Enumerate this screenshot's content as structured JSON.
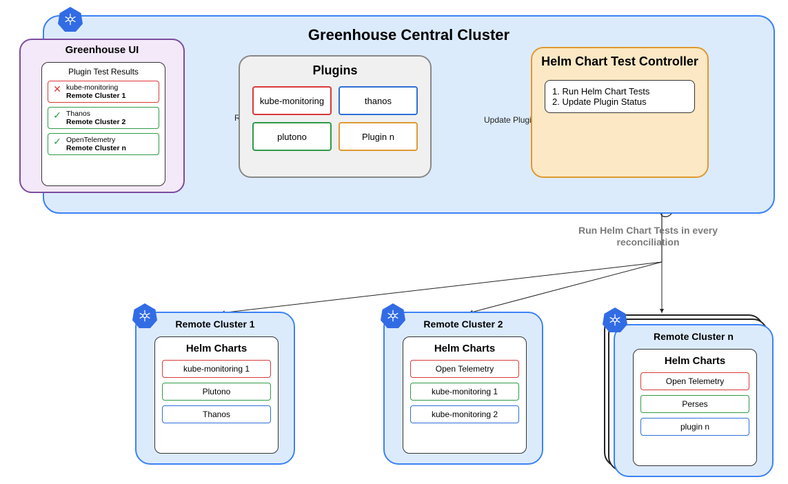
{
  "central": {
    "title": "Greenhouse Central Cluster",
    "ui": {
      "title": "Greenhouse UI",
      "results_title": "Plugin Test Results",
      "items": [
        {
          "status": "fail",
          "name": "kube-monitoring",
          "cluster": "Remote Cluster 1"
        },
        {
          "status": "ok",
          "name": "Thanos",
          "cluster": "Remote Cluster 2"
        },
        {
          "status": "ok",
          "name": "OpenTelemetry",
          "cluster": "Remote Cluster n"
        }
      ]
    },
    "plugins": {
      "title": "Plugins",
      "items": [
        {
          "name": "kube-monitoring",
          "color": "red"
        },
        {
          "name": "thanos",
          "color": "blue"
        },
        {
          "name": "plutono",
          "color": "green"
        },
        {
          "name": "Plugin n",
          "color": "orange"
        }
      ]
    },
    "controller": {
      "title": "Helm Chart Test Controller",
      "step1": "1. Run Helm Chart Tests",
      "step2": "2. Update Plugin Status"
    },
    "arrows": {
      "read": "Read",
      "update": "Update Plugin Status"
    }
  },
  "reconcile_label": "Run Helm Chart Tests in every reconciliation",
  "remotes": [
    {
      "title": "Remote Cluster 1",
      "charts_title": "Helm Charts",
      "charts": [
        {
          "name": "kube-monitoring 1",
          "color": "red"
        },
        {
          "name": "Plutono",
          "color": "green"
        },
        {
          "name": "Thanos",
          "color": "blue"
        }
      ]
    },
    {
      "title": "Remote Cluster 2",
      "charts_title": "Helm Charts",
      "charts": [
        {
          "name": "Open Telemetry",
          "color": "red"
        },
        {
          "name": "kube-monitoring 1",
          "color": "green"
        },
        {
          "name": "kube-monitoring 2",
          "color": "blue"
        }
      ]
    },
    {
      "title": "Remote Cluster n",
      "charts_title": "Helm Charts",
      "charts": [
        {
          "name": "Open Telemetry",
          "color": "red"
        },
        {
          "name": "Perses",
          "color": "green"
        },
        {
          "name": "plugin n",
          "color": "blue"
        }
      ]
    }
  ]
}
